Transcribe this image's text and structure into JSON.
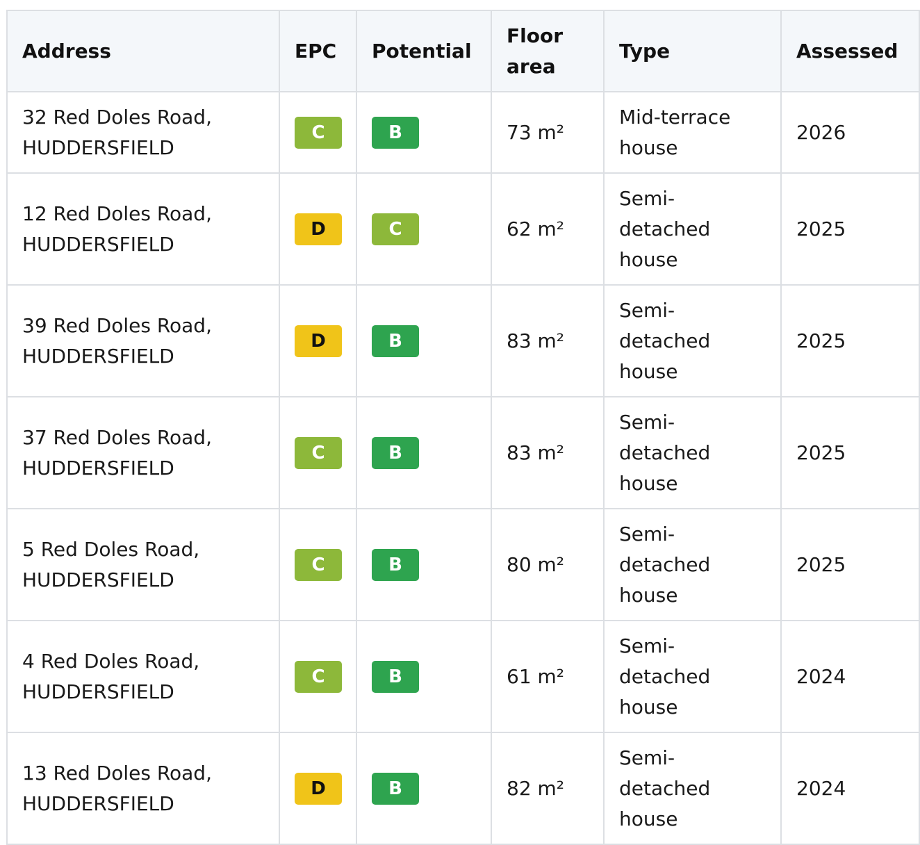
{
  "table": {
    "headers": {
      "address": "Address",
      "epc": "EPC",
      "potential": "Potential",
      "floor_line1": "Floor",
      "floor_line2": "area",
      "type": "Type",
      "assessed": "Assessed"
    },
    "colors": {
      "rating_b": "#2ea44f",
      "rating_c": "#8db83a",
      "rating_d": "#f0c419",
      "header_bg": "#f4f7fa",
      "border": "#dcdfe3"
    },
    "rows": [
      {
        "address_line1": "32 Red Doles Road,",
        "address_line2": "HUDDERSFIELD",
        "epc": "C",
        "potential": "B",
        "floor_area": "73 m²",
        "type_lines": [
          "Mid-terrace",
          "house"
        ],
        "assessed": "2026"
      },
      {
        "address_line1": "12 Red Doles Road,",
        "address_line2": "HUDDERSFIELD",
        "epc": "D",
        "potential": "C",
        "floor_area": "62 m²",
        "type_lines": [
          "Semi-",
          "detached",
          "house"
        ],
        "assessed": "2025"
      },
      {
        "address_line1": "39 Red Doles Road,",
        "address_line2": "HUDDERSFIELD",
        "epc": "D",
        "potential": "B",
        "floor_area": "83 m²",
        "type_lines": [
          "Semi-",
          "detached",
          "house"
        ],
        "assessed": "2025"
      },
      {
        "address_line1": "37 Red Doles Road,",
        "address_line2": "HUDDERSFIELD",
        "epc": "C",
        "potential": "B",
        "floor_area": "83 m²",
        "type_lines": [
          "Semi-",
          "detached",
          "house"
        ],
        "assessed": "2025"
      },
      {
        "address_line1": "5 Red Doles Road,",
        "address_line2": "HUDDERSFIELD",
        "epc": "C",
        "potential": "B",
        "floor_area": "80 m²",
        "type_lines": [
          "Semi-",
          "detached",
          "house"
        ],
        "assessed": "2025"
      },
      {
        "address_line1": "4 Red Doles Road,",
        "address_line2": "HUDDERSFIELD",
        "epc": "C",
        "potential": "B",
        "floor_area": "61 m²",
        "type_lines": [
          "Semi-",
          "detached",
          "house"
        ],
        "assessed": "2024"
      },
      {
        "address_line1": "13 Red Doles Road,",
        "address_line2": "HUDDERSFIELD",
        "epc": "D",
        "potential": "B",
        "floor_area": "82 m²",
        "type_lines": [
          "Semi-",
          "detached",
          "house"
        ],
        "assessed": "2024"
      }
    ]
  }
}
